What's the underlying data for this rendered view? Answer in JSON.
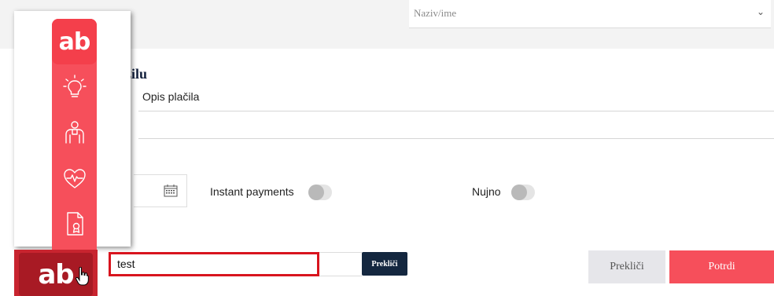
{
  "header": {
    "name_select_placeholder": "Naziv/ime"
  },
  "form": {
    "section_title": "azilu",
    "description_label": "Opis plačila",
    "instant_payments_label": "Instant payments",
    "urgent_label": "Nujno"
  },
  "launcher": {
    "logo_text": "ab",
    "icons": [
      "lightbulb-icon",
      "hand-coin-icon",
      "heart-pulse-icon",
      "document-badge-icon"
    ]
  },
  "footer": {
    "logo_text": "ab",
    "input_value": "test",
    "small_cancel_label": "Prekliči",
    "cancel_label": "Prekliči",
    "confirm_label": "Potrdi"
  },
  "colors": {
    "brand_red": "#f64f5b",
    "dark_red": "#a81a24",
    "navy": "#14273f",
    "focus_red": "#d8141e"
  }
}
